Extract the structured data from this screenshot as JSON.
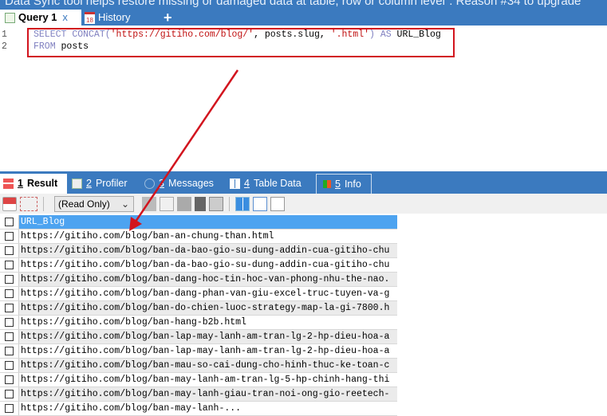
{
  "banner": "Data Sync tool helps restore missing or damaged data at table, row or column level\". Reason #34 to upgrade",
  "query_tabs": [
    {
      "label": "Query 1",
      "close": "x"
    },
    {
      "label": "History",
      "badge": "18"
    },
    {
      "label": "+"
    }
  ],
  "editor": {
    "lines": [
      {
        "num": "1",
        "kw1": "SELECT",
        "fn": "CONCAT(",
        "s1": "'https://gitiho.com/blog/'",
        "mid": ", posts.slug, ",
        "s2": "'.html'",
        "end": ") ",
        "kw2": "AS",
        "alias": " URL_Blog"
      },
      {
        "num": "2",
        "kw1": "FROM",
        "rest": " posts"
      }
    ]
  },
  "result_tabs": [
    {
      "num": "1",
      "label": "Result"
    },
    {
      "num": "2",
      "label": "Profiler"
    },
    {
      "num": "3",
      "label": "Messages"
    },
    {
      "num": "4",
      "label": "Table Data"
    },
    {
      "num": "5",
      "label": "Info"
    }
  ],
  "toolbar": {
    "mode": "(Read Only)"
  },
  "grid": {
    "header": "URL_Blog",
    "rows": [
      "https://gitiho.com/blog/ban-an-chung-than.html",
      "https://gitiho.com/blog/ban-da-bao-gio-su-dung-addin-cua-gitiho-chu",
      "https://gitiho.com/blog/ban-da-bao-gio-su-dung-addin-cua-gitiho-chu",
      "https://gitiho.com/blog/ban-dang-hoc-tin-hoc-van-phong-nhu-the-nao.",
      "https://gitiho.com/blog/ban-dang-phan-van-giu-excel-truc-tuyen-va-g",
      "https://gitiho.com/blog/ban-do-chien-luoc-strategy-map-la-gi-7800.h",
      "https://gitiho.com/blog/ban-hang-b2b.html",
      "https://gitiho.com/blog/ban-lap-may-lanh-am-tran-lg-2-hp-dieu-hoa-a",
      "https://gitiho.com/blog/ban-lap-may-lanh-am-tran-lg-2-hp-dieu-hoa-a",
      "https://gitiho.com/blog/ban-mau-so-cai-dung-cho-hinh-thuc-ke-toan-c",
      "https://gitiho.com/blog/ban-may-lanh-am-tran-lg-5-hp-chinh-hang-thi",
      "https://gitiho.com/blog/ban-may-lanh-giau-tran-noi-ong-gio-reetech-",
      "https://gitiho.com/blog/ban-may-lanh-..."
    ]
  },
  "colors": {
    "accent": "#3b7abf",
    "highlight": "#d2141e",
    "header_cell": "#4da3f0"
  }
}
